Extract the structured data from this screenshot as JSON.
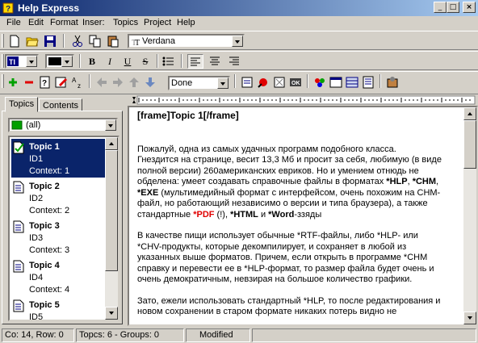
{
  "window": {
    "title": "Help Express"
  },
  "menu": [
    "File",
    "Edit",
    "Format",
    "Inser:",
    "Topics",
    "Project",
    "Help"
  ],
  "toolbar": {
    "font_name": "Verdana",
    "style_combo": "Done"
  },
  "tabs": [
    "Topics",
    "Contents"
  ],
  "topics_filter": "(all)",
  "topics": [
    {
      "title": "Topic 1",
      "id": "ID1",
      "context": "Context: 1",
      "selected": true
    },
    {
      "title": "Topic 2",
      "id": "ID2",
      "context": "Context: 2",
      "selected": false
    },
    {
      "title": "Topic 3",
      "id": "ID3",
      "context": "Context: 3",
      "selected": false
    },
    {
      "title": "Topic 4",
      "id": "ID4",
      "context": "Context: 4",
      "selected": false
    },
    {
      "title": "Topic 5",
      "id": "ID5",
      "context": "",
      "selected": false
    }
  ],
  "editor": {
    "heading": "[frame]Topic 1[/frame]",
    "p1_lines": [
      "Пожалуй, одна из самых удачных программ подобного класса.",
      "Гнездится на странице, весит 13,3 Мб и просит за себя, любимую (в виде",
      "полной версии) 260американских евриков. Но и умением отнюдь не",
      "обделена: умеет создавать справочные файлы в форматах *HLP, *CHM,",
      "*EXE (мультимедийный формат с интерфейсом, очень похожим на CHM-",
      "файл, но работающий независимо о версии и типа браузера), а также",
      "стандартные *PDF (!), *HTML и *Word-ззяды"
    ],
    "p2_lines": [
      "В качестве пищи использует обычные *RTF-файлы, либо *HLP- или",
      "*CHV-продукты, которые декомпилирует, и сохраняет в любой из",
      "указанных выше форматов. Причем, если открыть в программе *CHM",
      "справку и перевести ее в *HLP-формат, то размер файла будет очень и",
      "очень демократичным, невзирая на большое количество графики."
    ],
    "p3_lines": [
      "Зато, ежели использовать стандартный *HLP, то после редактирования и",
      "новом сохранении в старом формате никаких потерь видно не"
    ],
    "kw": {
      "hlp": "*HLP",
      "chm": "*CHM",
      "exe": "*EXE",
      "pdf": "*PDF",
      "html": "*HTML",
      "word": "*Word"
    }
  },
  "status": {
    "position": "Co: 14, Row: 0",
    "counts": "Topcs: 6 - Groups: 0",
    "state": "Modified"
  },
  "colors": {
    "selection": "#0a246a",
    "window_bg": "#d4d0c8",
    "accent_red": "#e00000"
  }
}
